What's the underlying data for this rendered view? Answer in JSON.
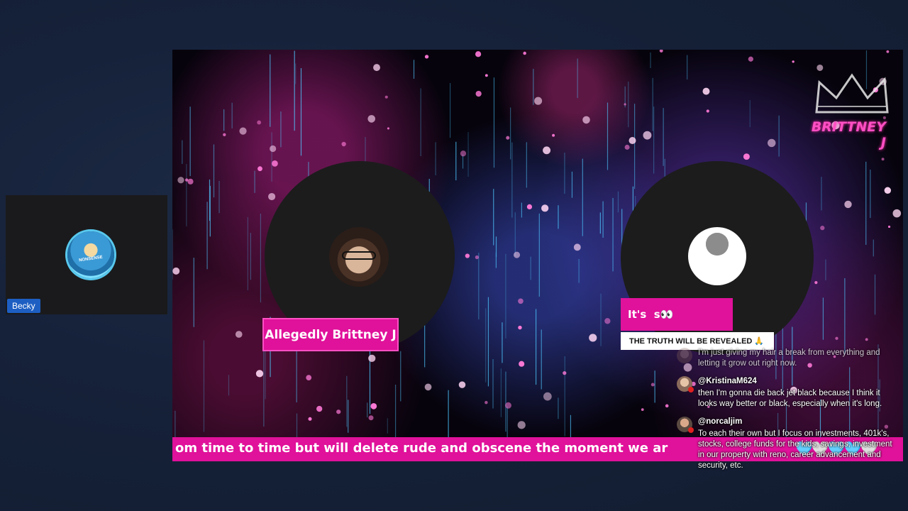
{
  "side_participant": {
    "name": "Becky",
    "avatar_text": "NONSENSE"
  },
  "stream": {
    "host_label": "Allegedly Brittney J",
    "guest_label": "It's ⁣⁣⁣⁣⁣⁣⁣ ⁣⁣⁣s👀",
    "guest_subtitle": "THE TRUTH WILL BE REVEALED 🙏",
    "brand_text": "BRITTNEY J",
    "ticker_text": "om time to time but will delete rude and obscene the moment we ar",
    "ticker_hearts": "🩵🤍🩵🩵🤍",
    "accent_color": "#e0119a"
  },
  "chat": [
    {
      "handle": "",
      "text": "I'm just giving my hair a break from everything and letting it grow out right now."
    },
    {
      "handle": "@KristinaM624",
      "text": "then I'm gonna die back jet black because I think it looks way better or black, especially when it's long."
    },
    {
      "handle": "@norcaljim",
      "text": "To each their own but I focus on investments, 401k's, stocks, college funds for the kids, savings, investment in our property with reno, career advancement and security, etc."
    }
  ]
}
